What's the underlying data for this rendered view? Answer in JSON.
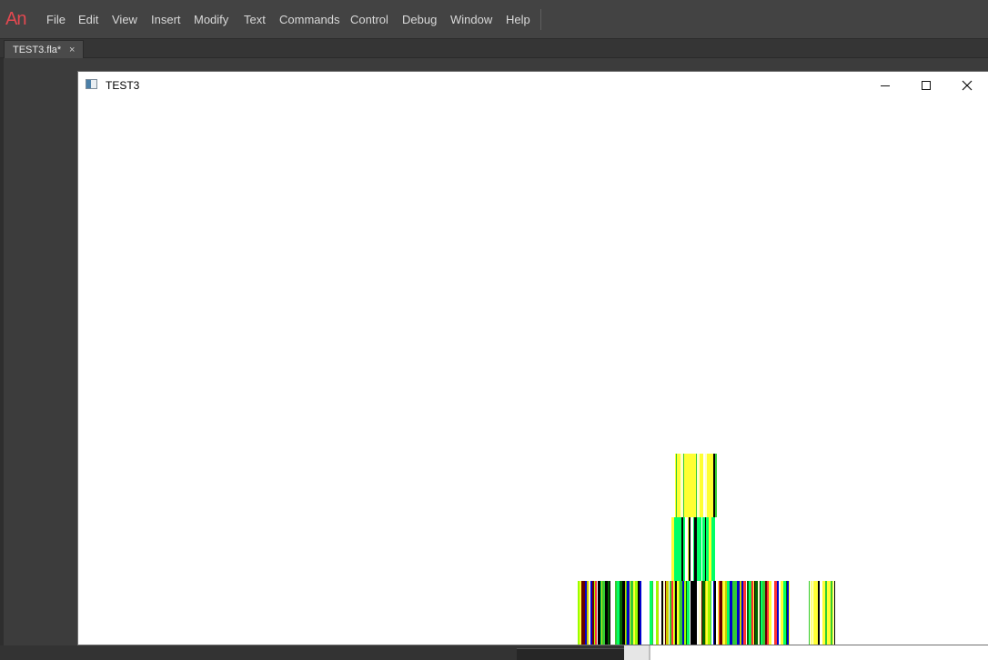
{
  "app": {
    "logo": "An",
    "menu": [
      "File",
      "Edit",
      "View",
      "Insert",
      "Modify",
      "Text",
      "Commands",
      "Control",
      "Debug",
      "Window",
      "Help"
    ]
  },
  "document_tab": {
    "label": "TEST3.fla*",
    "close": "×"
  },
  "player_window": {
    "title": "TEST3",
    "icons": {
      "minimize": "minimize-icon",
      "maximize": "maximize-icon",
      "close": "close-icon",
      "app": "app-window-icon"
    }
  },
  "colors": {
    "stripe_palette": [
      "#000000",
      "#ffff33",
      "#00ff66",
      "#33cc33",
      "#006600",
      "#99ff00",
      "#cccc00",
      "#ff3333",
      "#0000cc",
      "#660000",
      "#ffffcc"
    ]
  }
}
